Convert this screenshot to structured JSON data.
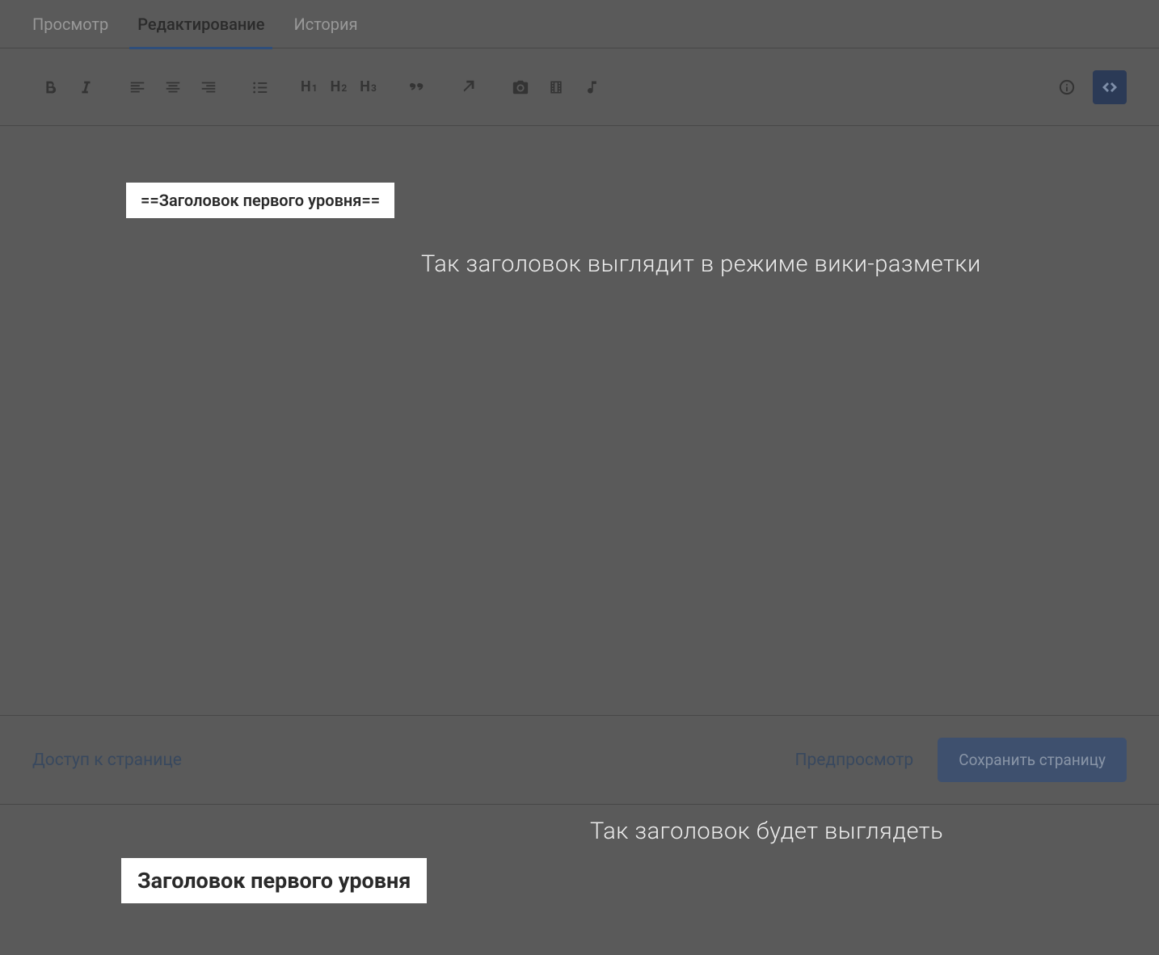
{
  "tabs": {
    "view": "Просмотр",
    "edit": "Редактирование",
    "history": "История"
  },
  "editor": {
    "markup_sample": "==Заголовок первого уровня=="
  },
  "annotations": {
    "markup_caption": "Так заголовок выглядит в режиме вики-разметки",
    "rendered_caption": "Так заголовок будет выглядеть"
  },
  "footer": {
    "access": "Доступ к странице",
    "preview": "Предпросмотр",
    "save": "Сохранить страницу"
  },
  "rendered": {
    "heading_text": "Заголовок первого уровня"
  }
}
